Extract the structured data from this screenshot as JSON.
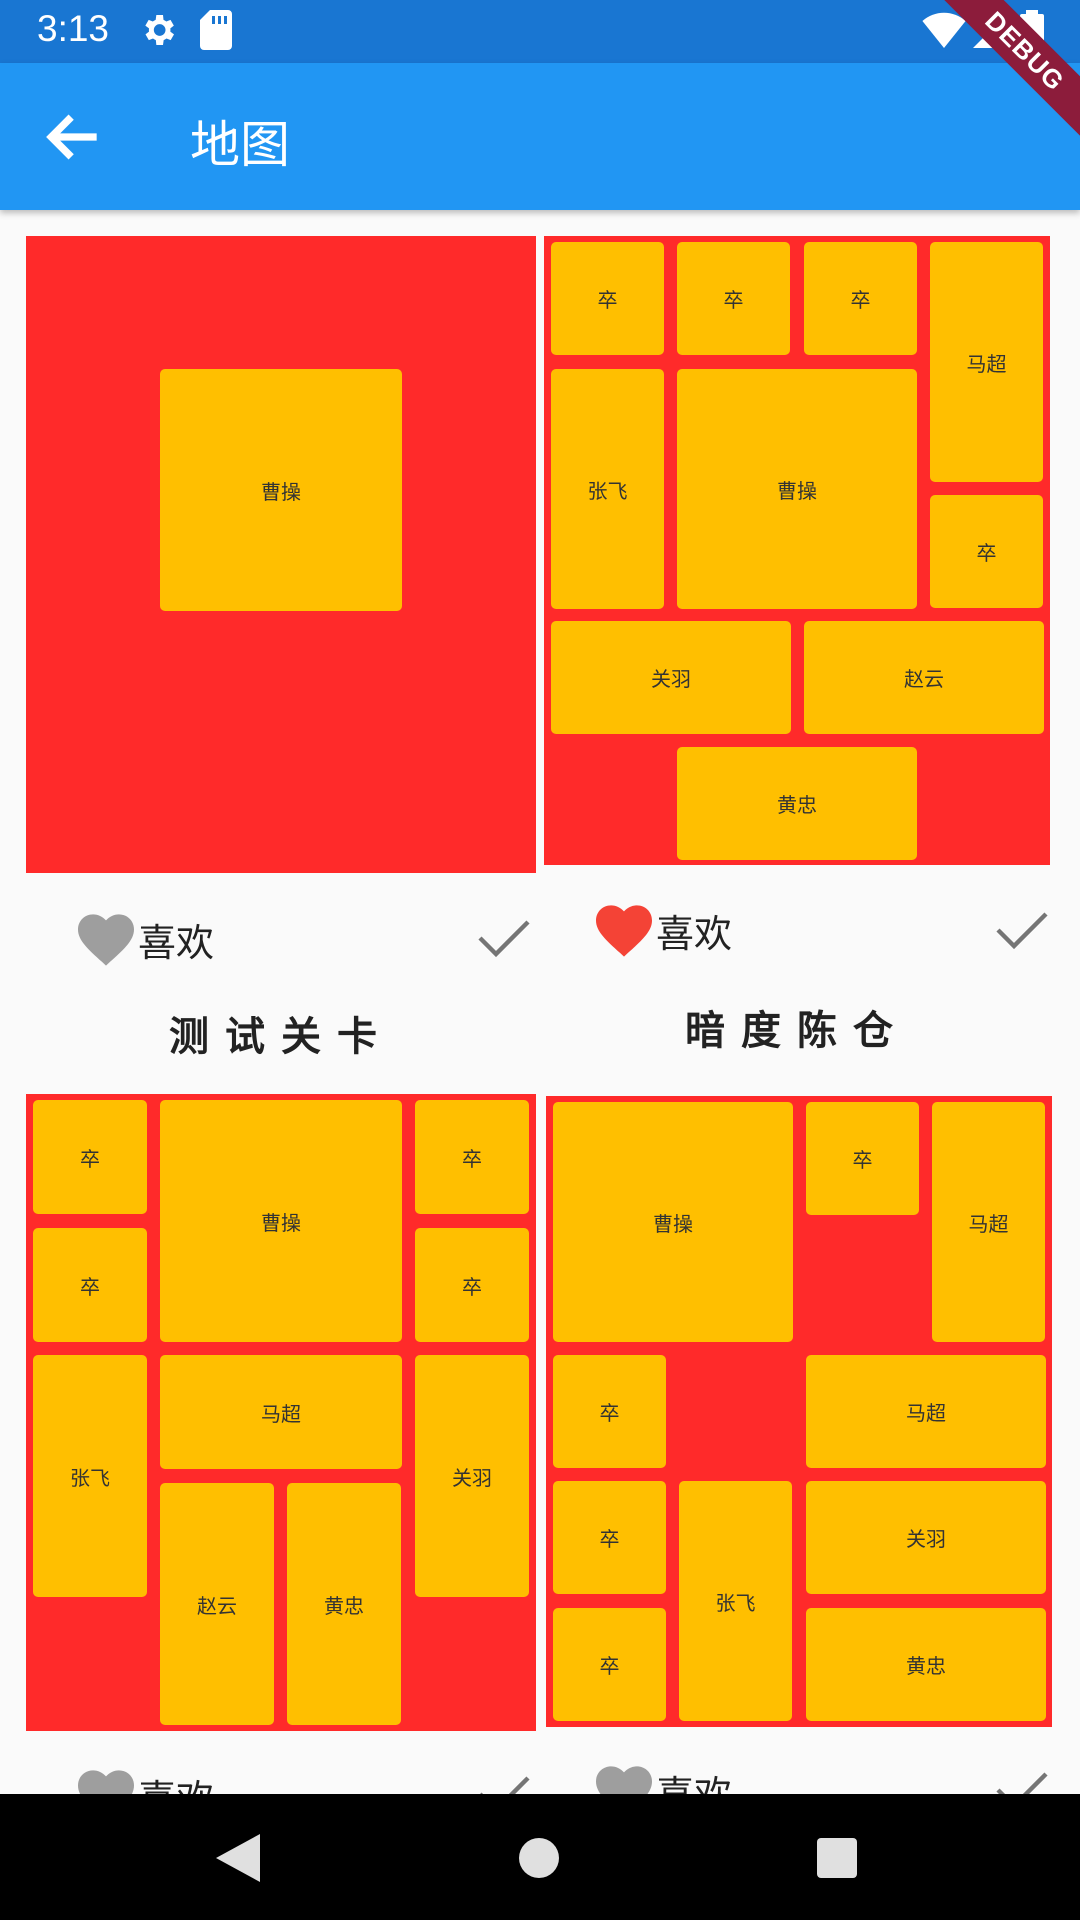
{
  "status": {
    "time": "3:13"
  },
  "appbar": {
    "title": "地图",
    "debug": "DEBUG"
  },
  "cards": [
    {
      "level_name": "测试关卡",
      "like_label": "喜欢",
      "liked": false,
      "pieces": [
        {
          "label": "曹操"
        }
      ]
    },
    {
      "level_name": "暗度陈仓",
      "like_label": "喜欢",
      "liked": true,
      "pieces": [
        {
          "label": "卒"
        },
        {
          "label": "卒"
        },
        {
          "label": "卒"
        },
        {
          "label": "马超"
        },
        {
          "label": "张飞"
        },
        {
          "label": "曹操"
        },
        {
          "label": "卒"
        },
        {
          "label": "关羽"
        },
        {
          "label": "赵云"
        },
        {
          "label": "黄忠"
        }
      ]
    },
    {
      "level_name": "",
      "like_label": "喜欢",
      "liked": false,
      "pieces": [
        {
          "label": "卒"
        },
        {
          "label": "曹操"
        },
        {
          "label": "卒"
        },
        {
          "label": "卒"
        },
        {
          "label": "卒"
        },
        {
          "label": "张飞"
        },
        {
          "label": "马超"
        },
        {
          "label": "关羽"
        },
        {
          "label": "赵云"
        },
        {
          "label": "黄忠"
        }
      ]
    },
    {
      "level_name": "",
      "like_label": "喜欢",
      "liked": false,
      "pieces": [
        {
          "label": "曹操"
        },
        {
          "label": "卒"
        },
        {
          "label": "马超"
        },
        {
          "label": "卒"
        },
        {
          "label": "马超"
        },
        {
          "label": "卒"
        },
        {
          "label": "张飞"
        },
        {
          "label": "关羽"
        },
        {
          "label": "卒"
        },
        {
          "label": "黄忠"
        }
      ]
    }
  ],
  "colors": {
    "board": "#ff2a2a",
    "piece": "#ffbf00",
    "appbar": "#2196f3",
    "liked": "#f44336",
    "unliked": "#9e9e9e"
  }
}
